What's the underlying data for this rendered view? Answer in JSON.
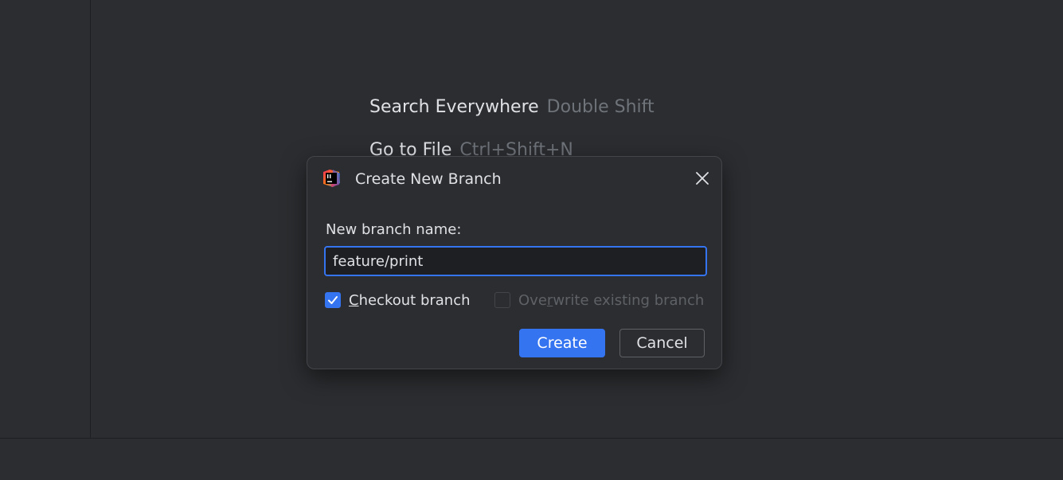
{
  "editor": {
    "hints": [
      {
        "action": "Search Everywhere",
        "shortcut": "Double Shift"
      },
      {
        "action": "Go to File",
        "shortcut": "Ctrl+Shift+N"
      }
    ]
  },
  "dialog": {
    "title": "Create New Branch",
    "icon": "intellij-idea-logo-icon",
    "field_label": "New branch name:",
    "branch_name_value": "feature/print",
    "checkout_checkbox": {
      "prefix": "",
      "mnemonic": "C",
      "rest": "heckout branch",
      "checked": true,
      "enabled": true
    },
    "overwrite_checkbox": {
      "prefix": "Ove",
      "mnemonic": "r",
      "rest": "write existing branch",
      "checked": false,
      "enabled": false
    },
    "create_label": "Create",
    "cancel_label": "Cancel"
  },
  "colors": {
    "accent": "#3574f0",
    "background": "#2b2d30",
    "text": "#dfe1e5",
    "muted": "#6f737a"
  }
}
